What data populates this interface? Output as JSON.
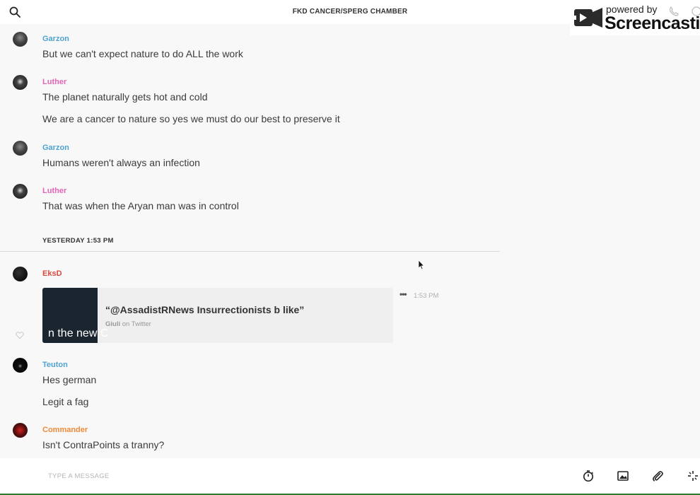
{
  "header": {
    "title": "FKD CANCER/SPERG CHAMBER"
  },
  "watermark": {
    "small_text": "powered by",
    "brand": "Screencastify"
  },
  "messages": [
    {
      "user": "Garzon",
      "lines": [
        "But we can't expect nature to do ALL the work"
      ]
    },
    {
      "user": "Luther",
      "lines": [
        "The planet naturally gets hot and cold",
        "We are a cancer to nature so yes we must do our best to preserve it"
      ]
    },
    {
      "user": "Garzon",
      "lines": [
        "Humans weren't always an infection"
      ]
    },
    {
      "user": "Luther",
      "lines": [
        "That was when the Aryan man was in control"
      ]
    }
  ],
  "day_divider": "YESTERDAY 1:53 PM",
  "later_messages": {
    "eksd": {
      "user": "EksD",
      "embed": {
        "title": "“@AssadistRNews Insurrectionists b like”",
        "author": "Giuli",
        "source": " on Twitter",
        "thumb_text": "n the new C"
      },
      "time": "1:53 PM",
      "more": "•••"
    },
    "teuton": {
      "user": "Teuton",
      "lines": [
        "Hes german",
        "Legit a fag"
      ]
    },
    "commander": {
      "user": "Commander",
      "lines": [
        "Isn't ContraPoints a tranny?"
      ]
    }
  },
  "composer": {
    "placeholder": "TYPE A MESSAGE"
  },
  "colors": {
    "blue_user": "#4ea3d2",
    "pink_user": "#e065b8",
    "red_user": "#d84a3c",
    "orange_user": "#ee8b3a"
  },
  "icons": [
    "search-icon",
    "phone-icon",
    "info-icon",
    "heart-icon",
    "timer-icon",
    "image-icon",
    "paperclip-icon",
    "sparkle-icon"
  ]
}
